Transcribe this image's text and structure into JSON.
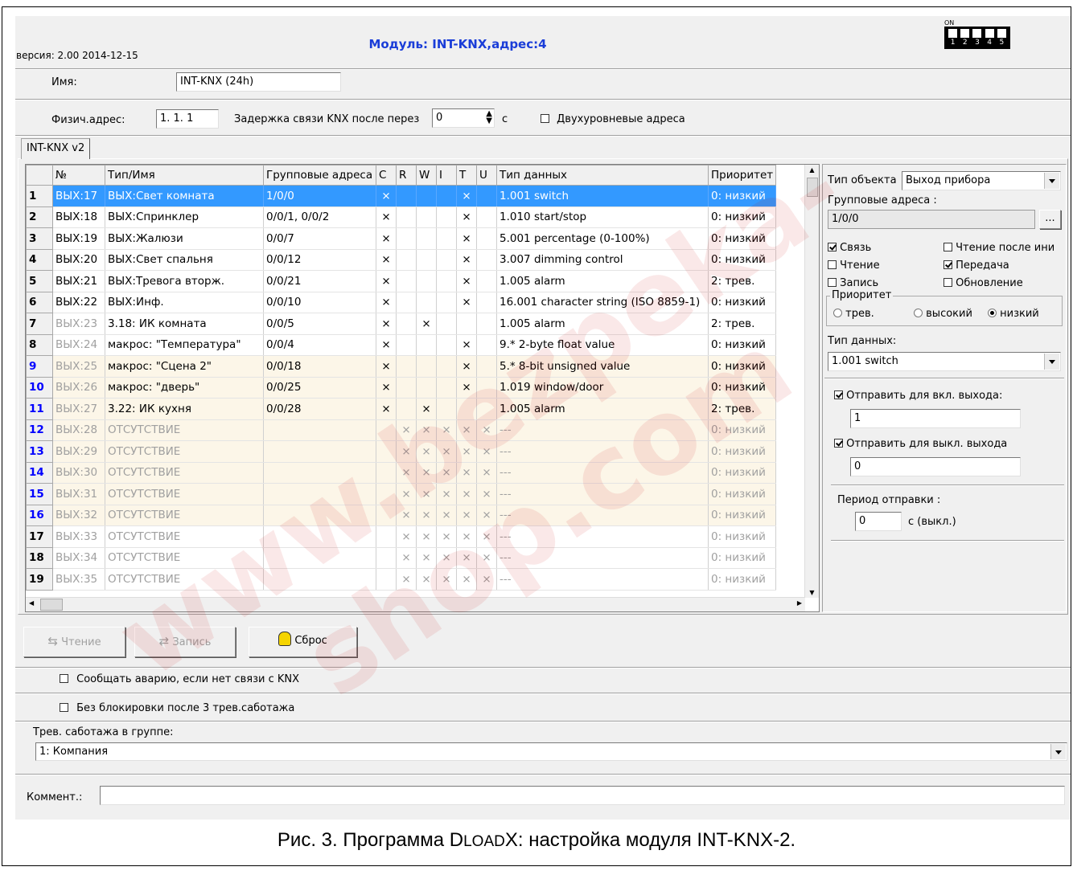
{
  "header": {
    "title": "Модуль: INT-KNX,адрес:4",
    "version": "версия: 2.00 2014-12-15",
    "dip_labels": [
      "1",
      "2",
      "3",
      "4",
      "5"
    ]
  },
  "name_row": {
    "label": "Имя:",
    "value": "INT-KNX  (24h)"
  },
  "phys_row": {
    "label": "Физич.адрес:",
    "value": "1. 1. 1",
    "delay_label": "Задержка связи KNX после перез",
    "delay_value": "0",
    "delay_unit": "с",
    "two_level_label": "Двухуровневые адреса"
  },
  "tab": {
    "label": "INT-KNX v2"
  },
  "table": {
    "headers": [
      "№",
      "Тип/Имя",
      "Групповые адреса",
      "C",
      "R",
      "W",
      "I",
      "T",
      "U",
      "Тип данных",
      "Приоритет"
    ],
    "rows": [
      {
        "n": "1",
        "no": "ВЫХ:17",
        "name": "ВЫХ:Свет комната",
        "addr": "1/0/0",
        "c": "×",
        "r": "",
        "w": "",
        "i": "",
        "t": "×",
        "u": "",
        "dtype": "1.001 switch",
        "prio": "0: низкий"
      },
      {
        "n": "2",
        "no": "ВЫХ:18",
        "name": "ВЫХ:Спринклер",
        "addr": "0/0/1, 0/0/2",
        "c": "×",
        "r": "",
        "w": "",
        "i": "",
        "t": "×",
        "u": "",
        "dtype": "1.010 start/stop",
        "prio": "0: низкий"
      },
      {
        "n": "3",
        "no": "ВЫХ:19",
        "name": "ВЫХ:Жалюзи",
        "addr": "0/0/7",
        "c": "×",
        "r": "",
        "w": "",
        "i": "",
        "t": "×",
        "u": "",
        "dtype": "5.001 percentage (0-100%)",
        "prio": "0: низкий"
      },
      {
        "n": "4",
        "no": "ВЫХ:20",
        "name": "ВЫХ:Свет спальня",
        "addr": "0/0/12",
        "c": "×",
        "r": "",
        "w": "",
        "i": "",
        "t": "×",
        "u": "",
        "dtype": "3.007 dimming control",
        "prio": "0: низкий"
      },
      {
        "n": "5",
        "no": "ВЫХ:21",
        "name": "ВЫХ:Тревога вторж.",
        "addr": "0/0/21",
        "c": "×",
        "r": "",
        "w": "",
        "i": "",
        "t": "×",
        "u": "",
        "dtype": "1.005 alarm",
        "prio": "2: трев."
      },
      {
        "n": "6",
        "no": "ВЫХ:22",
        "name": "ВЫХ:Инф.",
        "addr": "0/0/10",
        "c": "×",
        "r": "",
        "w": "",
        "i": "",
        "t": "×",
        "u": "",
        "dtype": "16.001 character string (ISO 8859-1)",
        "prio": "0: низкий"
      },
      {
        "n": "7",
        "no": "ВЫХ:23",
        "name": "3.18: ИК комната",
        "addr": "0/0/5",
        "c": "×",
        "r": "",
        "w": "×",
        "i": "",
        "t": "",
        "u": "",
        "dtype": "1.005 alarm",
        "prio": "2: трев."
      },
      {
        "n": "8",
        "no": "ВЫХ:24",
        "name": "макрос: \"Температура\"",
        "addr": "0/0/4",
        "c": "×",
        "r": "",
        "w": "",
        "i": "",
        "t": "×",
        "u": "",
        "dtype": "9.* 2-byte float value",
        "prio": "0: низкий"
      },
      {
        "n": "9",
        "no": "ВЫХ:25",
        "name": "макрос: \"Сцена 2\"",
        "addr": "0/0/18",
        "c": "×",
        "r": "",
        "w": "",
        "i": "",
        "t": "×",
        "u": "",
        "dtype": "5.* 8-bit unsigned value",
        "prio": "0: низкий"
      },
      {
        "n": "10",
        "no": "ВЫХ:26",
        "name": "макрос: \"дверь\"",
        "addr": "0/0/25",
        "c": "×",
        "r": "",
        "w": "",
        "i": "",
        "t": "×",
        "u": "",
        "dtype": "1.019 window/door",
        "prio": "0: низкий"
      },
      {
        "n": "11",
        "no": "ВЫХ:27",
        "name": "3.22: ИК кухня",
        "addr": "0/0/28",
        "c": "×",
        "r": "",
        "w": "×",
        "i": "",
        "t": "",
        "u": "",
        "dtype": "1.005 alarm",
        "prio": "2: трев."
      },
      {
        "n": "12",
        "no": "ВЫХ:28",
        "name": "ОТСУТСТВИЕ",
        "addr": "",
        "c": "",
        "r": "×",
        "w": "×",
        "i": "×",
        "t": "×",
        "u": "×",
        "dtype": "---",
        "prio": "0: низкий"
      },
      {
        "n": "13",
        "no": "ВЫХ:29",
        "name": "ОТСУТСТВИЕ",
        "addr": "",
        "c": "",
        "r": "×",
        "w": "×",
        "i": "×",
        "t": "×",
        "u": "×",
        "dtype": "---",
        "prio": "0: низкий"
      },
      {
        "n": "14",
        "no": "ВЫХ:30",
        "name": "ОТСУТСТВИЕ",
        "addr": "",
        "c": "",
        "r": "×",
        "w": "×",
        "i": "×",
        "t": "×",
        "u": "×",
        "dtype": "---",
        "prio": "0: низкий"
      },
      {
        "n": "15",
        "no": "ВЫХ:31",
        "name": "ОТСУТСТВИЕ",
        "addr": "",
        "c": "",
        "r": "×",
        "w": "×",
        "i": "×",
        "t": "×",
        "u": "×",
        "dtype": "---",
        "prio": "0: низкий"
      },
      {
        "n": "16",
        "no": "ВЫХ:32",
        "name": "ОТСУТСТВИЕ",
        "addr": "",
        "c": "",
        "r": "×",
        "w": "×",
        "i": "×",
        "t": "×",
        "u": "×",
        "dtype": "---",
        "prio": "0: низкий"
      },
      {
        "n": "17",
        "no": "ВЫХ:33",
        "name": "ОТСУТСТВИЕ",
        "addr": "",
        "c": "",
        "r": "×",
        "w": "×",
        "i": "×",
        "t": "×",
        "u": "×",
        "dtype": "---",
        "prio": "0: низкий"
      },
      {
        "n": "18",
        "no": "ВЫХ:34",
        "name": "ОТСУТСТВИЕ",
        "addr": "",
        "c": "",
        "r": "×",
        "w": "×",
        "i": "×",
        "t": "×",
        "u": "×",
        "dtype": "---",
        "prio": "0: низкий"
      },
      {
        "n": "19",
        "no": "ВЫХ:35",
        "name": "ОТСУТСТВИЕ",
        "addr": "",
        "c": "",
        "r": "×",
        "w": "×",
        "i": "×",
        "t": "×",
        "u": "×",
        "dtype": "---",
        "prio": "0: низкий"
      }
    ]
  },
  "props": {
    "obj_type_label": "Тип объекта",
    "obj_type_value": "Выход прибора",
    "group_addr_label": "Групповые адреса :",
    "group_addr_value": "1/0/0",
    "browse_label": "...",
    "flags": {
      "link": "Связь",
      "read_after_init": "Чтение после ини",
      "read": "Чтение",
      "transmit": "Передача",
      "write": "Запись",
      "update": "Обновление"
    },
    "priority_label": "Приоритет",
    "priority_options": {
      "alarm": "трев.",
      "high": "высокий",
      "low": "низкий"
    },
    "data_type_label": "Тип данных:",
    "data_type_value": "1.001 switch",
    "send_on_label": "Отправить для вкл. выхода:",
    "send_on_value": "1",
    "send_off_label": "Отправить для выкл. выхода",
    "send_off_value": "0",
    "period_label": "Период отправки :",
    "period_value": "0",
    "period_unit": "с (выкл.)"
  },
  "buttons": {
    "read": "Чтение",
    "write": "Запись",
    "reset": "Сброс"
  },
  "options": {
    "report_failure": "Сообщать аварию, если нет связи с KNX",
    "no_block": "Без блокировки после 3 трев.саботажа"
  },
  "tamper": {
    "label": "Трев. саботажа в группе:",
    "value": "1: Компания"
  },
  "comment": {
    "label": "Коммент.:",
    "value": ""
  },
  "caption": {
    "prefix": "Рис. 3. Программа ",
    "app_d": "D",
    "app_load": "LOAD",
    "app_x": "X",
    "suffix": ": настройка модуля INT-KNX-2."
  },
  "watermark": "www.bezpeka-shop.com"
}
